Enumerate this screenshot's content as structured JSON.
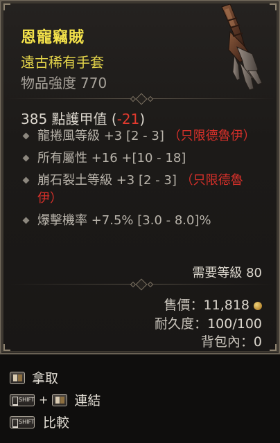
{
  "item": {
    "name": "恩寵竊賊",
    "type": "遠古稀有手套",
    "power_label": "物品強度",
    "power_value": "770",
    "icon": "gauntlet-icon"
  },
  "armor": {
    "value": "385",
    "label": "點護甲值",
    "open_paren": "(",
    "delta": "-21",
    "close_paren": ")"
  },
  "affixes": [
    {
      "text": "龍捲風等級 +3 [2 - 3]",
      "restriction": "（只限德魯伊）"
    },
    {
      "text": "所有屬性 +16 +[10 - 18]",
      "restriction": ""
    },
    {
      "text": "崩石裂土等級 +3 [2 - 3]",
      "restriction": "（只限德魯伊）"
    },
    {
      "text": "爆擊機率 +7.5% [3.0 - 8.0]%",
      "restriction": ""
    }
  ],
  "requirement": {
    "text": "需要等級 80"
  },
  "stats": {
    "sell_label": "售價：",
    "sell_value": "11,818",
    "durability_label": "耐久度：",
    "durability_value": "100/100",
    "inventory_label": "背包內：",
    "inventory_value": "0"
  },
  "actions": {
    "take": "拿取",
    "link": "連結",
    "compare": "比較",
    "plus": "+",
    "shift_key": "SHIFT"
  },
  "colors": {
    "rare_name": "#f4e24a",
    "negative": "#e23a2e",
    "restriction": "#d8302a"
  }
}
